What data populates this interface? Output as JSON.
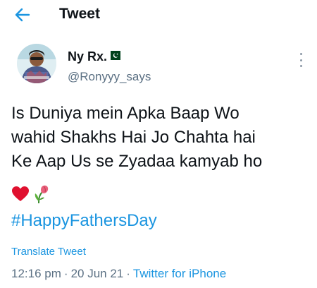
{
  "header": {
    "title": "Tweet",
    "back_icon": "arrow-left-icon"
  },
  "author": {
    "display_name": "Ny Rx.",
    "handle": "@Ronyyy_says",
    "flag_icon": "pakistan-flag-icon"
  },
  "tweet": {
    "lines": [
      "Is Duniya mein Apka Baap Wo",
      "wahid Shakhs Hai Jo Chahta hai",
      "Ke Aap Us se Zyadaa kamyab ho"
    ],
    "emojis": [
      "red-heart-emoji",
      "wilted-flower-emoji"
    ],
    "hashtag": "#HappyFathersDay"
  },
  "translate_label": "Translate Tweet",
  "meta": {
    "time": "12:16 pm",
    "separator": "·",
    "date": "20 Jun 21",
    "source": "Twitter for iPhone"
  },
  "colors": {
    "accent": "#1b95e0",
    "text": "#0f1419",
    "secondary": "#5b7083"
  }
}
